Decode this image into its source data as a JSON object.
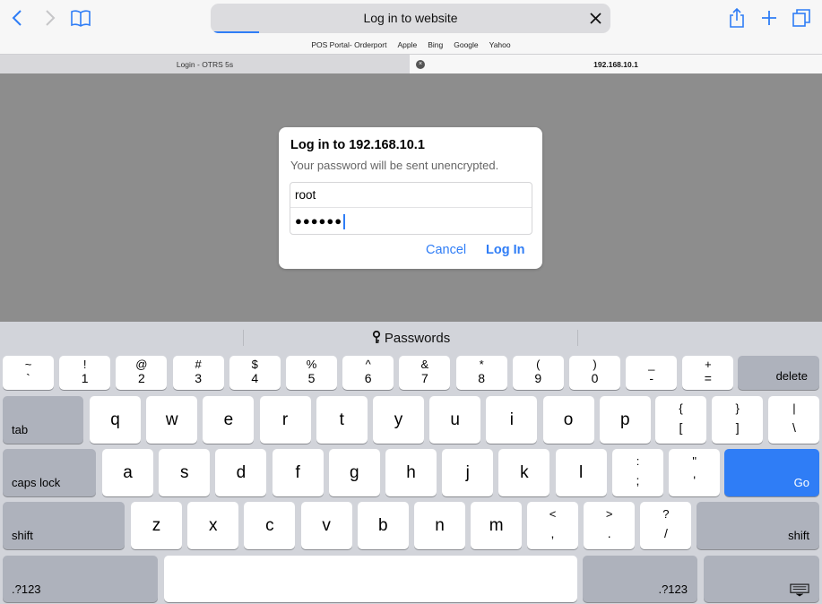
{
  "toolbar": {
    "address_text": "Log in to website",
    "load_progress": 0.12
  },
  "favorites": [
    "POS Portal- Orderport",
    "Apple",
    "Bing",
    "Google",
    "Yahoo"
  ],
  "tabs": [
    {
      "label": "Login - OTRS 5s"
    },
    {
      "label": "192.168.10.1",
      "close_glyph": "×"
    }
  ],
  "dialog": {
    "title": "Log in to 192.168.10.1",
    "message": "Your password will be sent unencrypted.",
    "username": "root",
    "password_mask": "●●●●●●",
    "cancel_label": "Cancel",
    "login_label": "Log In"
  },
  "keyboard": {
    "suggestion_label": "Passwords",
    "row1": [
      {
        "top": "~",
        "bot": "`"
      },
      {
        "top": "!",
        "bot": "1"
      },
      {
        "top": "@",
        "bot": "2"
      },
      {
        "top": "#",
        "bot": "3"
      },
      {
        "top": "$",
        "bot": "4"
      },
      {
        "top": "%",
        "bot": "5"
      },
      {
        "top": "^",
        "bot": "6"
      },
      {
        "top": "&",
        "bot": "7"
      },
      {
        "top": "*",
        "bot": "8"
      },
      {
        "top": "(",
        "bot": "9"
      },
      {
        "top": ")",
        "bot": "0"
      },
      {
        "top": "_",
        "bot": "-"
      },
      {
        "top": "+",
        "bot": "="
      }
    ],
    "delete_label": "delete",
    "tab_label": "tab",
    "row2": [
      "q",
      "w",
      "e",
      "r",
      "t",
      "y",
      "u",
      "i",
      "o",
      "p"
    ],
    "row2_sym": [
      {
        "top": "{",
        "bot": "["
      },
      {
        "top": "}",
        "bot": "]"
      },
      {
        "top": "|",
        "bot": "\\"
      }
    ],
    "caps_label": "caps lock",
    "row3": [
      "a",
      "s",
      "d",
      "f",
      "g",
      "h",
      "j",
      "k",
      "l"
    ],
    "row3_sym": [
      {
        "top": ":",
        "bot": ";"
      },
      {
        "top": "\"",
        "bot": "'"
      }
    ],
    "go_label": "Go",
    "shift_label": "shift",
    "row4": [
      "z",
      "x",
      "c",
      "v",
      "b",
      "n",
      "m"
    ],
    "row4_sym": [
      {
        "top": "<",
        "bot": ","
      },
      {
        "top": ">",
        "bot": "."
      },
      {
        "top": "?",
        "bot": "/"
      }
    ],
    "numbers_label": ".?123"
  },
  "colors": {
    "accent": "#2f7df6",
    "content_bg": "#8d8d8d",
    "keyboard_bg": "#d2d4da"
  }
}
